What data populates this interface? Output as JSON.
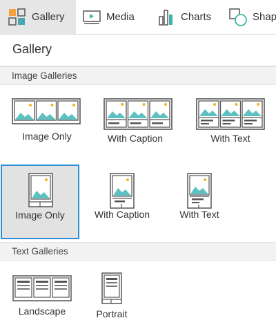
{
  "tabs": [
    {
      "label": "Gallery",
      "icon": "gallery-icon",
      "active": true
    },
    {
      "label": "Media",
      "icon": "media-icon"
    },
    {
      "label": "Charts",
      "icon": "charts-icon"
    },
    {
      "label": "Shapes",
      "icon": "shapes-icon"
    }
  ],
  "panel": {
    "title": "Gallery"
  },
  "sections": {
    "image": {
      "title": "Image Galleries",
      "landscape": [
        {
          "label": "Image Only"
        },
        {
          "label": "With Caption"
        },
        {
          "label": "With Text"
        }
      ],
      "portrait": [
        {
          "label": "Image Only",
          "selected": true
        },
        {
          "label": "With Caption"
        },
        {
          "label": "With Text"
        }
      ]
    },
    "text": {
      "title": "Text Galleries",
      "items": [
        {
          "label": "Landscape"
        },
        {
          "label": "Portrait"
        }
      ]
    }
  },
  "colors": {
    "accent": "#2a8fd6",
    "image_teal": "#5cc1c0",
    "sun": "#f5b324",
    "outline": "#555555",
    "selected_bg": "#e2e2e2",
    "section_bg": "#f2f2f2"
  }
}
